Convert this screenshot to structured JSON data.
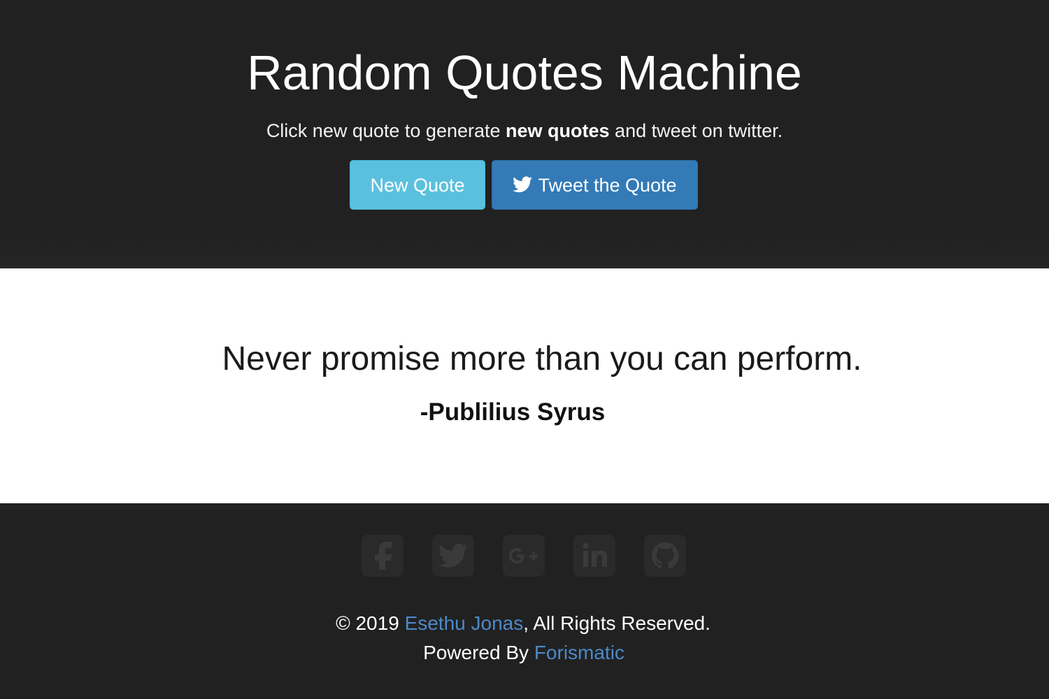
{
  "header": {
    "title": "Random Quotes Machine",
    "subtitle_pre": "Click new quote to generate ",
    "subtitle_bold": "new quotes",
    "subtitle_post": " and tweet on twitter.",
    "new_quote_label": "New Quote",
    "tweet_label": "Tweet the Quote",
    "tweet_icon": "twitter-bird-icon"
  },
  "quote": {
    "text": "Never promise more than you can perform.",
    "author": "-Publilius Syrus"
  },
  "footer": {
    "social_icons": [
      "facebook-icon",
      "twitter-icon",
      "google-plus-icon",
      "linkedin-icon",
      "github-icon"
    ],
    "copyright_pre": "© 2019 ",
    "author_link": "Esethu Jonas",
    "copyright_post": ", All Rights Reserved.",
    "powered_pre": "Powered By ",
    "powered_link": "Forismatic"
  },
  "colors": {
    "dark_background": "#212121",
    "new_quote_button": "#5bc0de",
    "tweet_button": "#337ab7",
    "link": "#4d89c9",
    "social_icon_bg": "#2a2a2a",
    "social_icon_fg": "#3a3a3a"
  }
}
